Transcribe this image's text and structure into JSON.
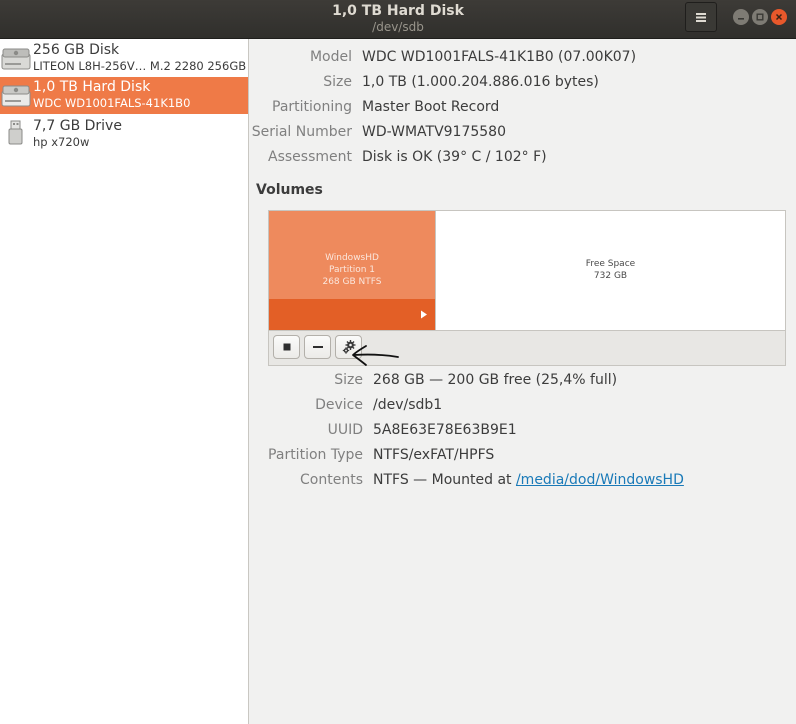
{
  "window": {
    "title": "1,0 TB Hard Disk",
    "subtitle": "/dev/sdb",
    "icons": {
      "menu": "hamburger-menu-icon",
      "minimize": "minimize-icon",
      "maximize": "maximize-icon",
      "close": "close-icon"
    }
  },
  "sidebar": {
    "items": [
      {
        "name": "256 GB Disk",
        "detail": "LITEON L8H-256V… M.2 2280 256GB",
        "icon": "hard-disk-icon",
        "selected": false
      },
      {
        "name": "1,0 TB Hard Disk",
        "detail": "WDC WD1001FALS-41K1B0",
        "icon": "hard-disk-icon",
        "selected": true
      },
      {
        "name": "7,7 GB Drive",
        "detail": "hp x720w",
        "icon": "usb-drive-icon",
        "selected": false
      }
    ]
  },
  "disk_info": {
    "rows": [
      {
        "label": "Model",
        "value": "WDC WD1001FALS-41K1B0 (07.00K07)"
      },
      {
        "label": "Size",
        "value": "1,0 TB (1.000.204.886.016 bytes)"
      },
      {
        "label": "Partitioning",
        "value": "Master Boot Record"
      },
      {
        "label": "Serial Number",
        "value": "WD-WMATV9175580"
      },
      {
        "label": "Assessment",
        "value": "Disk is OK (39° C / 102° F)"
      }
    ]
  },
  "volumes": {
    "title": "Volumes",
    "partitions": [
      {
        "lines": [
          "WindowsHD",
          "Partition 1",
          "268 GB NTFS"
        ],
        "selected": true,
        "share": 0.268
      },
      {
        "lines": [
          "Free Space",
          "732 GB"
        ],
        "selected": false,
        "share": 0.732
      }
    ],
    "toolbar": {
      "unmount_icon": "stop-square-icon",
      "delete_icon": "minus-icon",
      "settings_icon": "gears-icon",
      "annotation_icon": "hand-drawn-arrow-icon"
    }
  },
  "partition_info": {
    "rows": [
      {
        "label": "Size",
        "value": "268 GB — 200 GB free (25,4% full)"
      },
      {
        "label": "Device",
        "value": "/dev/sdb1"
      },
      {
        "label": "UUID",
        "value": "5A8E63E78E63B9E1"
      },
      {
        "label": "Partition Type",
        "value": "NTFS/exFAT/HPFS"
      },
      {
        "label": "Contents",
        "value_prefix": "NTFS — Mounted at ",
        "link": "/media/dod/WindowsHD"
      }
    ]
  },
  "colors": {
    "accent": "#ef7a47",
    "partition_fill": "#ee8a5d",
    "partition_bar": "#e35f26",
    "link": "#1a7ab8",
    "titlebar": "#302f2c"
  }
}
